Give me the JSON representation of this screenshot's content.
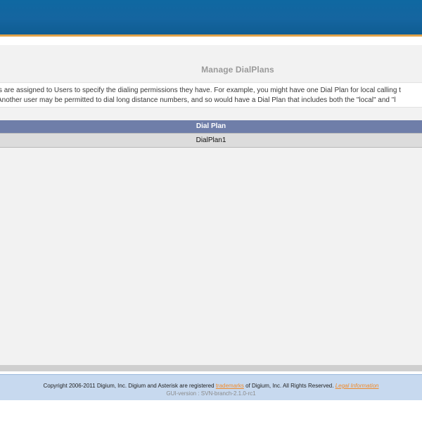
{
  "page": {
    "title": "Manage DialPlans"
  },
  "description": {
    "line1": "s are assigned to Users to specify the dialing permissions they have. For example, you might have one Dial Plan for local calling t",
    "line2": "Another user may be permitted to dial long distance numbers, and so would have a Dial Plan that includes both the \"local\" and \"l"
  },
  "table": {
    "columns": [
      "Dial Plan"
    ],
    "rows": [
      [
        "DialPlan1"
      ]
    ]
  },
  "footer": {
    "copyright_prefix": "Copyright 2006-2011 Digium, Inc. Digium and Asterisk are registered",
    "trademarks_label": "trademarks",
    "copyright_suffix": "of Digium, Inc. All Rights Reserved.",
    "legal_label": "Legal Information",
    "gui_version": "GUI-version : SVN-branch-2.1.0-rc1"
  },
  "colors": {
    "header_blue": "#1565a0",
    "header_accent": "#e0a24a",
    "table_header": "#6f7ea9",
    "footer_background": "#c7d9ef",
    "link_orange": "#f08a2a"
  }
}
